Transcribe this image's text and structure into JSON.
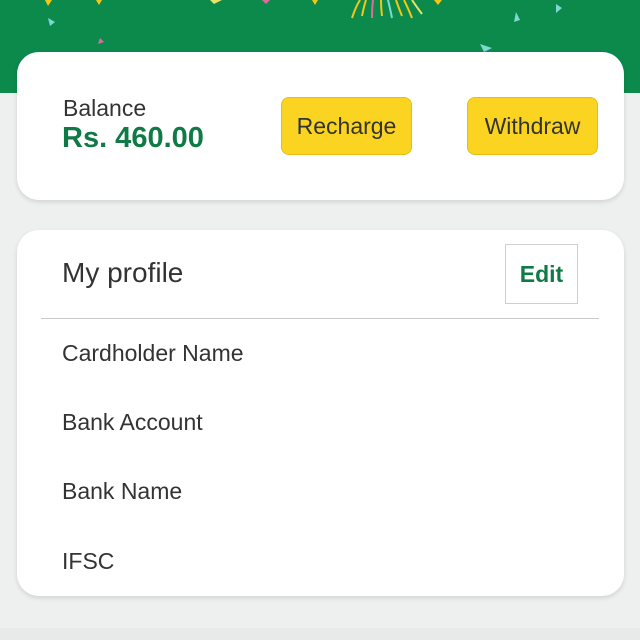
{
  "colors": {
    "banner": "#0b8a4c",
    "accent_green": "#0f7a45",
    "button_yellow": "#fbd421",
    "page_background": "#eeefef"
  },
  "balance": {
    "label": "Balance",
    "amount": "Rs. 460.00",
    "recharge_label": "Recharge",
    "withdraw_label": "Withdraw"
  },
  "profile": {
    "title": "My profile",
    "edit_label": "Edit",
    "fields": [
      "Cardholder Name",
      "Bank Account",
      "Bank Name",
      "IFSC"
    ]
  }
}
